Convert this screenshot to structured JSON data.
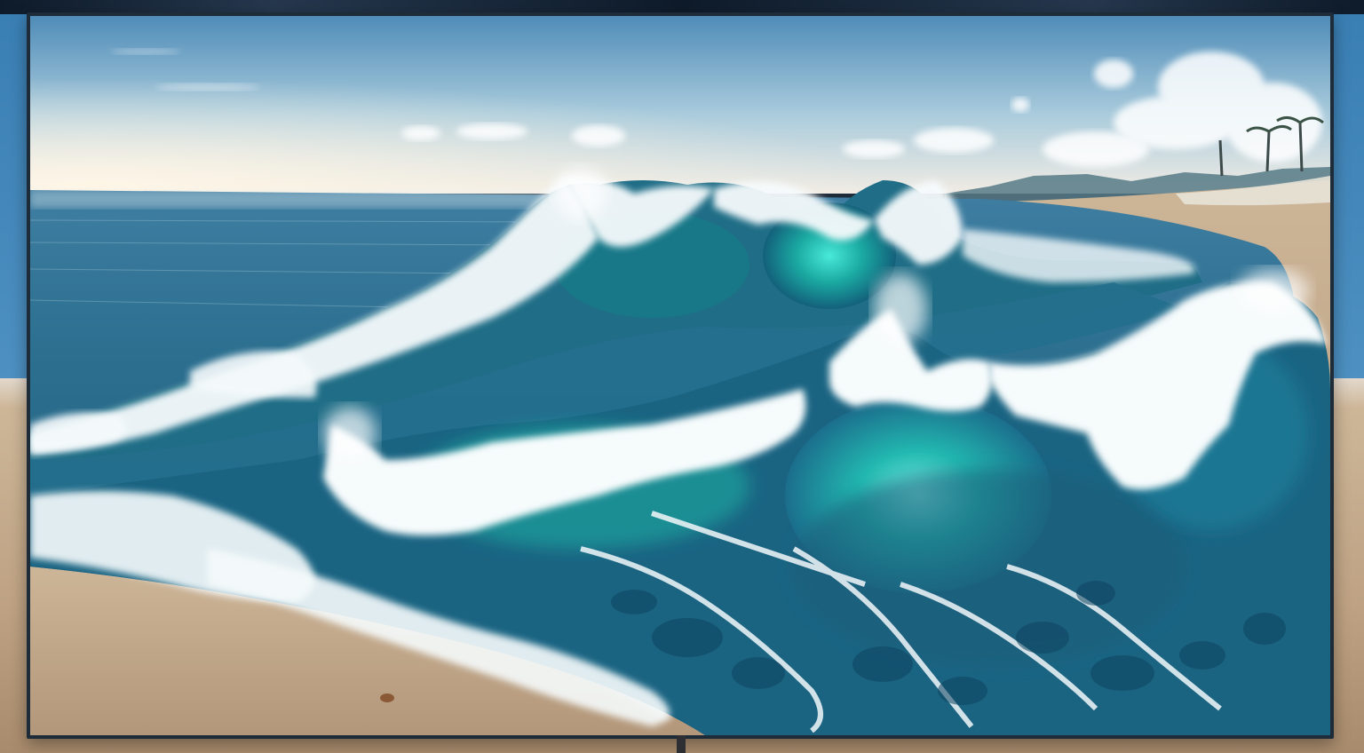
{
  "scene": {
    "subject": "",
    "colors": {
      "sky_top": "#5f97bf",
      "sky_horizon": "#e9eef0",
      "ocean_deep": "#1c5776",
      "ocean_teal": "#1fa6a0",
      "wave_glow": "#3fe0d2",
      "foam": "#f4f9fb",
      "sand": "#c8ad8f",
      "frame": "#1e2b38"
    }
  }
}
